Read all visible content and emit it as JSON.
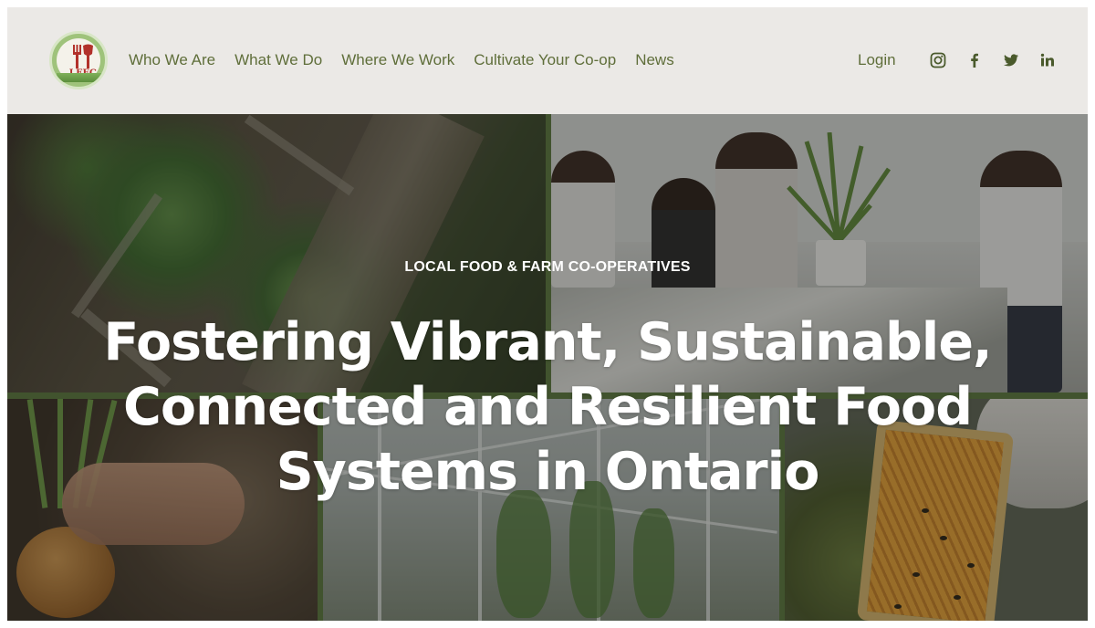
{
  "logo": {
    "text": "LFFC",
    "icon": "fork-and-spade-logo-icon"
  },
  "nav": {
    "items": [
      "Who We Are",
      "What We Do",
      "Where We Work",
      "Cultivate Your Co-op",
      "News"
    ]
  },
  "header": {
    "login_label": "Login",
    "social_icons": [
      "instagram-icon",
      "facebook-icon",
      "twitter-icon",
      "linkedin-icon"
    ]
  },
  "hero": {
    "eyebrow": "LOCAL FOOD & FARM CO-OPERATIVES",
    "headline_line1": "Fostering Vibrant, Sustainable,",
    "headline_line2": "Connected and Resilient Food",
    "headline_line3": "Systems in Ontario"
  },
  "colors": {
    "header_bg": "#ebe9e6",
    "nav_text": "#5f6e3a",
    "logo_green": "#9fc37b",
    "logo_red": "#b2312b",
    "tile_divider": "#5d7a40"
  }
}
